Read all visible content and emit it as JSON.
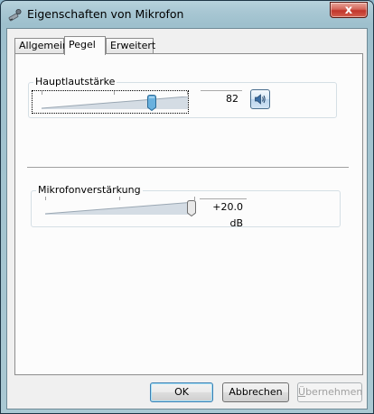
{
  "window": {
    "title": "Eigenschaften von Mikrofon",
    "close_glyph": "x",
    "icon": "microphone-icon"
  },
  "tabs": [
    {
      "label": "Allgemein",
      "selected": false
    },
    {
      "label": "Pegel",
      "selected": true
    },
    {
      "label": "Erweitert",
      "selected": false
    }
  ],
  "levels": {
    "main_volume": {
      "label": "Hauptlautstärke",
      "value": "82",
      "level_percent": 82,
      "speaker_icon": "speaker-icon"
    },
    "mic_boost": {
      "label": "Mikrofonverstärkung",
      "value": "+20.0 dB",
      "level_percent": 100
    }
  },
  "buttons": {
    "ok": "OK",
    "cancel": "Abbrechen",
    "apply_first": "Ü",
    "apply_rest": "bernehmen",
    "apply_enabled": false
  },
  "colors": {
    "slider_ramp": "#d4dce4",
    "thumb_blue": "#6ab1de",
    "accent_border": "#3c7fb1"
  }
}
